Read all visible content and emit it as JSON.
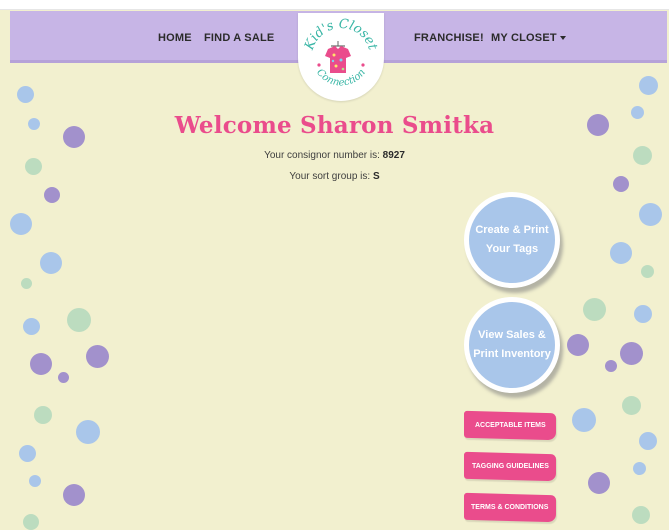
{
  "nav": {
    "home": "HOME",
    "find_a_sale": "FIND A SALE",
    "franchise": "FRANCHISE!",
    "my_closet": "MY CLOSET"
  },
  "logo": {
    "name": "Kid's Closet Connection"
  },
  "main": {
    "welcome": "Welcome Sharon Smitka",
    "consignor_label": "Your consignor number is: ",
    "consignor_number": "8927",
    "sort_label": "Your sort group is: ",
    "sort_group": "S"
  },
  "actions": {
    "create_tags_line1": "Create & Print",
    "create_tags_line2": "Your Tags",
    "view_sales_line1": "View Sales &",
    "view_sales_line2": "Print Inventory"
  },
  "links": {
    "acceptable_items": "ACCEPTABLE ITEMS",
    "tagging_guidelines": "TAGGING GUIDELINES",
    "terms": "TERMS & CONDITIONS"
  },
  "colors": {
    "navbar": "#c7b5e6",
    "background": "#f2f0cf",
    "accent_pink": "#ea4c8c",
    "bubble_blue": "#a9c6ea",
    "bubble_purple": "#a291cc",
    "bubble_green": "#bcdcbf"
  }
}
